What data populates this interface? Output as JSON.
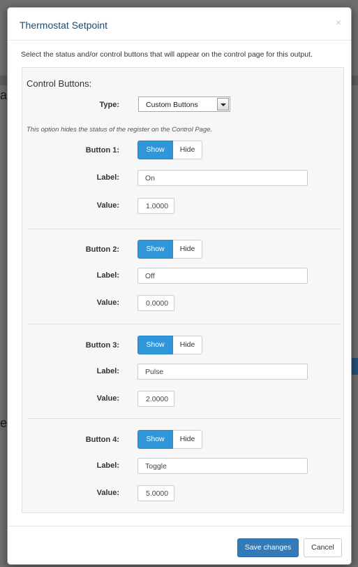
{
  "background": {
    "glyph_a": "a",
    "glyph_e": "e"
  },
  "dialog": {
    "title": "Thermostat Setpoint",
    "close_label": "×",
    "intro": "Select the status and/or control buttons that will appear on the control page for this output."
  },
  "control_buttons": {
    "heading": "Control Buttons:",
    "type_label": "Type:",
    "type_value": "Custom Buttons",
    "hint": "This option hides the status of the register on the Control Page.",
    "show_label": "Show",
    "hide_label": "Hide",
    "label_label": "Label:",
    "value_label": "Value:",
    "buttons": [
      {
        "name": "Button 1:",
        "label": "On",
        "value": "1.0000"
      },
      {
        "name": "Button 2:",
        "label": "Off",
        "value": "0.0000"
      },
      {
        "name": "Button 3:",
        "label": "Pulse",
        "value": "2.0000"
      },
      {
        "name": "Button 4:",
        "label": "Toggle",
        "value": "5.0000"
      }
    ]
  },
  "footer": {
    "save_label": "Save changes",
    "cancel_label": "Cancel"
  },
  "colors": {
    "accent": "#2f96dc",
    "primary": "#337ab7",
    "title": "#214a6e"
  }
}
